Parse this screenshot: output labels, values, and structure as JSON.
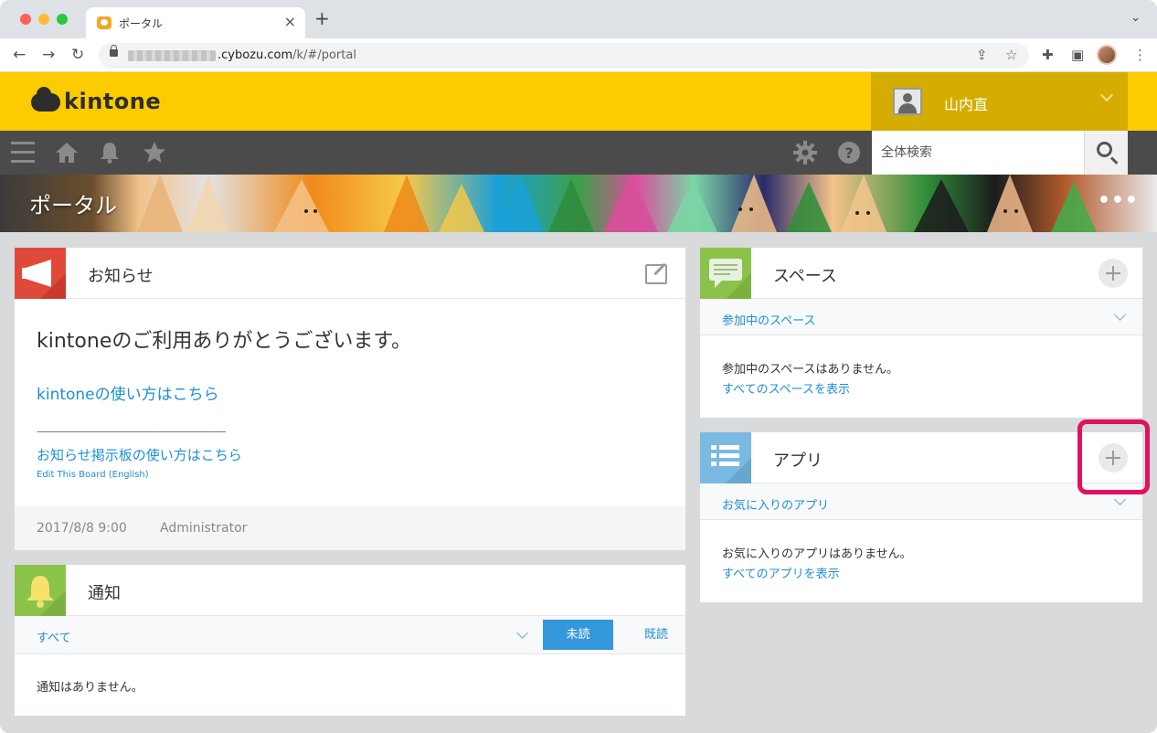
{
  "browser": {
    "tab_title": "ポータル",
    "url_domain": ".cybozu.com",
    "url_path": "/k/#/portal"
  },
  "header": {
    "logo_text": "kintone",
    "user_name": "山内直",
    "search_placeholder": "全体検索"
  },
  "banner": {
    "title": "ポータル",
    "more_label": "•••"
  },
  "news": {
    "title": "お知らせ",
    "heading": "kintoneのご利用ありがとうございます。",
    "link_howto": "kintoneの使い方はこちら",
    "divider": "--------------------------------------------------------------",
    "link_board": "お知らせ掲示板の使い方はこちら",
    "link_english": "Edit This Board (English)",
    "date": "2017/8/8 9:00",
    "author": "Administrator"
  },
  "notifications": {
    "title": "通知",
    "filter": "すべて",
    "unread_label": "未読",
    "read_label": "既読",
    "empty": "通知はありません。"
  },
  "spaces": {
    "title": "スペース",
    "filter": "参加中のスペース",
    "empty": "参加中のスペースはありません。",
    "show_all": "すべてのスペースを表示"
  },
  "apps": {
    "title": "アプリ",
    "filter": "お気に入りのアプリ",
    "empty": "お気に入りのアプリはありません。",
    "show_all": "すべてのアプリを表示"
  },
  "colors": {
    "header_yellow": "#fccc00",
    "user_box": "#d4ad00",
    "toolbar": "#4b4b4b",
    "link_blue": "#1d8fd6",
    "unread_button": "#3498db",
    "news_icon": "#e0493a",
    "green_icon": "#8bc34a",
    "apps_icon": "#7ab9e2",
    "highlight": "#e0115f"
  },
  "icons": [
    "hamburger-icon",
    "home-icon",
    "bell-icon",
    "star-icon",
    "gear-icon",
    "help-icon",
    "search-icon",
    "megaphone-icon",
    "chat-icon",
    "list-icon",
    "plus-icon",
    "edit-icon",
    "chevron-down-icon"
  ]
}
